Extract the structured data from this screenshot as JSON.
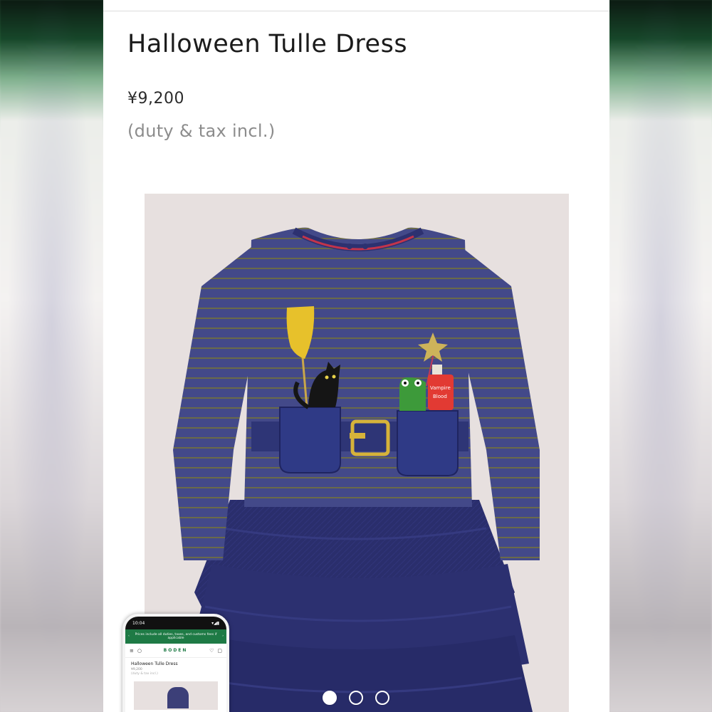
{
  "product": {
    "title": "Halloween Tulle Dress",
    "price": "¥9,200",
    "tax_note": "(duty & tax incl.)"
  },
  "gallery": {
    "slide_count": 3,
    "active_slide": 1,
    "image_alt": "Halloween Tulle Dress"
  },
  "phone_preview": {
    "status_time": "10:04",
    "banner": "Prices include all duties, taxes, and customs fees if applicable",
    "logo": "BODEN",
    "title": "Halloween Tulle Dress",
    "price": "¥9,200",
    "tax_note": "(duty & tax incl.)"
  },
  "colors": {
    "dress_navy": "#3d4283",
    "tulle_navy": "#262a66",
    "background": "#e7e0df",
    "brand_green": "#1e7a45"
  },
  "icons": [
    "menu-icon",
    "search-icon",
    "heart-icon",
    "bag-icon",
    "chevron-left-icon",
    "chevron-right-icon"
  ]
}
